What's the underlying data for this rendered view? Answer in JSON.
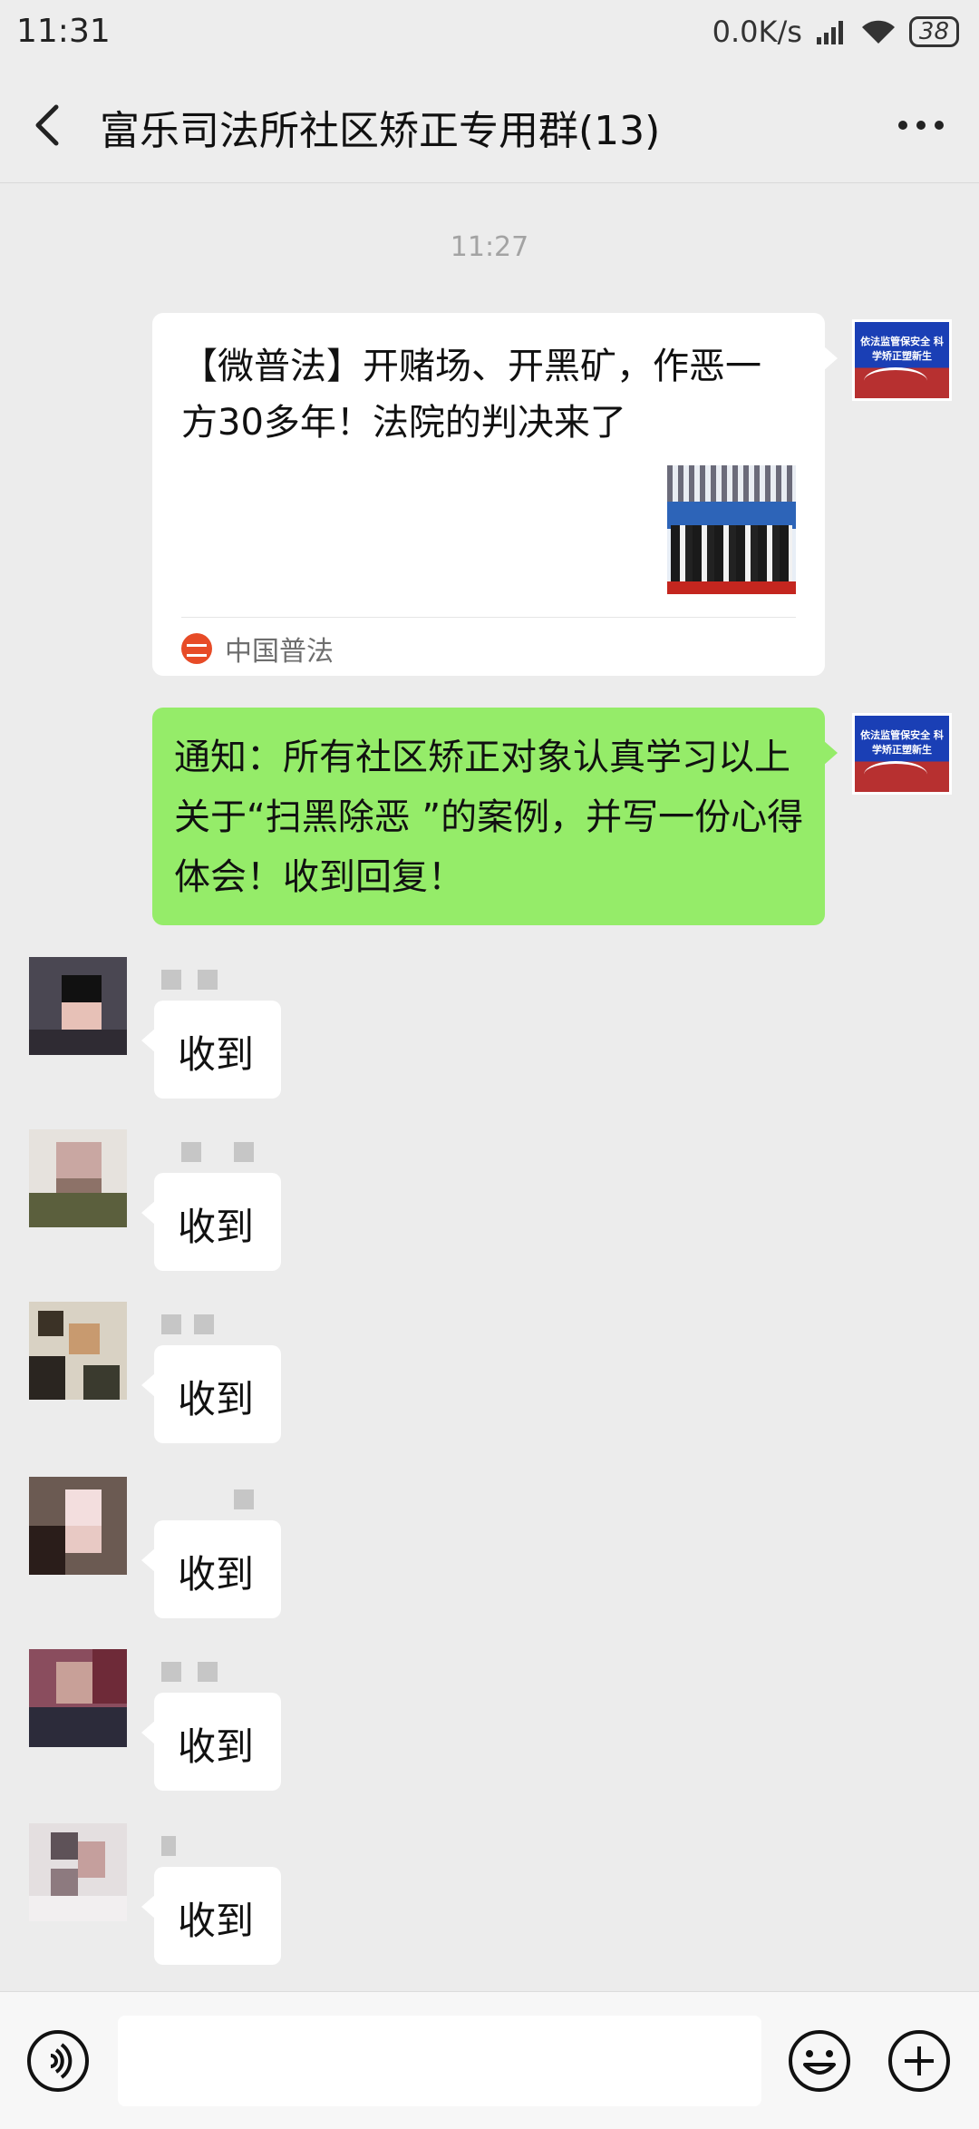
{
  "status_bar": {
    "time": "11:31",
    "network_speed": "0.0K/s",
    "battery": "38"
  },
  "header": {
    "title": "富乐司法所社区矫正专用群(13)"
  },
  "timestamp": "11:27",
  "link_card": {
    "title": "【微普法】开赌场、开黑矿，作恶一方30多年！法院的判决来了",
    "source": "中国普法"
  },
  "avatar_logo_text": "依法监管保安全 科学矫正塑新生",
  "notice": {
    "text": "通知：所有社区矫正对象认真学习以上关于“扫黑除恶 ”的案例，并写一份心得体会！收到回复！"
  },
  "replies": [
    {
      "text": "收到"
    },
    {
      "text": "收到"
    },
    {
      "text": "收到"
    },
    {
      "text": "收到"
    },
    {
      "text": "收到"
    },
    {
      "text": "收到"
    }
  ],
  "colors": {
    "sent_bubble": "#95ec69",
    "background": "#ececec",
    "bubble": "#ffffff"
  }
}
